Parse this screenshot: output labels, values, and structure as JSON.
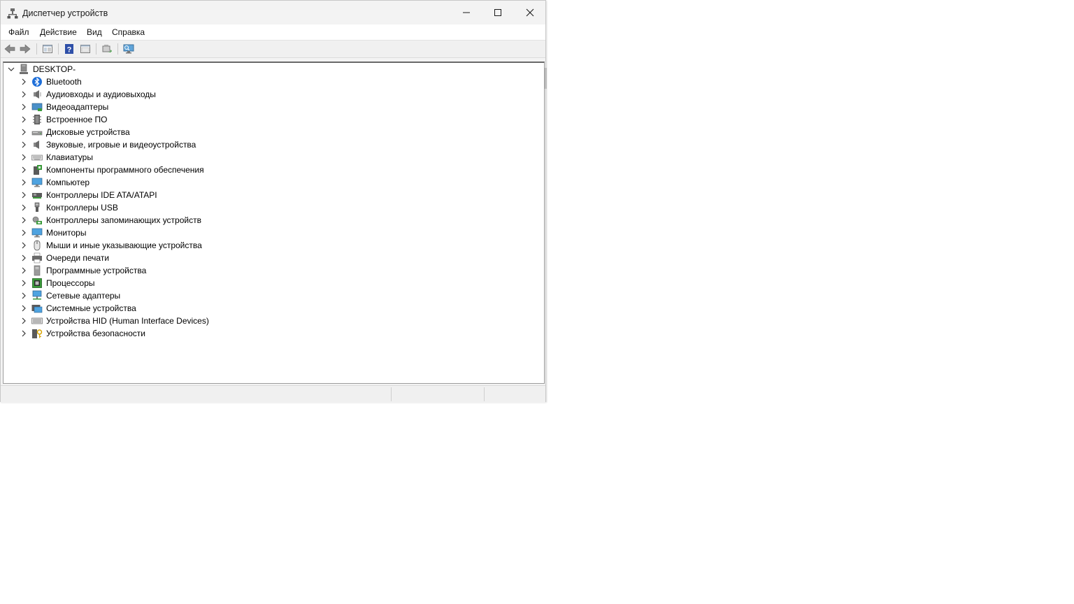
{
  "window": {
    "title": "Диспетчер устройств"
  },
  "menu": [
    "Файл",
    "Действие",
    "Вид",
    "Справка"
  ],
  "toolbar": [
    "back-icon",
    "forward-icon",
    "show-hide-console-tree-icon",
    "help-icon",
    "properties-icon",
    "update-driver-icon",
    "scan-hardware-icon"
  ],
  "tree": {
    "root": "DESKTOP-",
    "items": [
      {
        "label": "Bluetooth",
        "icon": "bluetooth-icon"
      },
      {
        "label": "Аудиовходы и аудиовыходы",
        "icon": "speaker-icon"
      },
      {
        "label": "Видеоадаптеры",
        "icon": "display-adapter-icon"
      },
      {
        "label": "Встроенное ПО",
        "icon": "firmware-icon"
      },
      {
        "label": "Дисковые устройства",
        "icon": "disk-drive-icon"
      },
      {
        "label": "Звуковые, игровые и видеоустройства",
        "icon": "sound-icon"
      },
      {
        "label": "Клавиатуры",
        "icon": "keyboard-icon"
      },
      {
        "label": "Компоненты программного обеспечения",
        "icon": "software-component-icon"
      },
      {
        "label": "Компьютер",
        "icon": "computer-icon"
      },
      {
        "label": "Контроллеры IDE ATA/ATAPI",
        "icon": "ide-controller-icon"
      },
      {
        "label": "Контроллеры USB",
        "icon": "usb-icon"
      },
      {
        "label": "Контроллеры запоминающих устройств",
        "icon": "storage-controller-icon"
      },
      {
        "label": "Мониторы",
        "icon": "monitor-icon"
      },
      {
        "label": "Мыши и иные указывающие устройства",
        "icon": "mouse-icon"
      },
      {
        "label": "Очереди печати",
        "icon": "printer-icon"
      },
      {
        "label": "Программные устройства",
        "icon": "software-device-icon"
      },
      {
        "label": "Процессоры",
        "icon": "processor-icon"
      },
      {
        "label": "Сетевые адаптеры",
        "icon": "network-adapter-icon"
      },
      {
        "label": "Системные устройства",
        "icon": "system-device-icon"
      },
      {
        "label": "Устройства HID (Human Interface Devices)",
        "icon": "hid-icon"
      },
      {
        "label": "Устройства безопасности",
        "icon": "security-device-icon"
      }
    ]
  }
}
